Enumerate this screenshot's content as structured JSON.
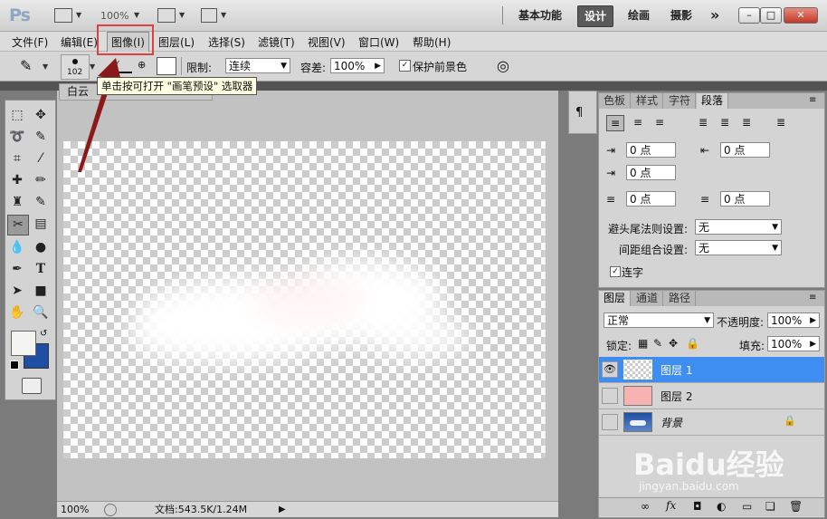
{
  "app": {
    "logo": "Ps",
    "zoom": "100%"
  },
  "workspaces": {
    "basic": "基本功能",
    "design": "设计",
    "paint": "绘画",
    "photo": "摄影",
    "more": "»"
  },
  "window_buttons": {
    "minimize": "–",
    "maximize": "□",
    "close": "✕"
  },
  "menu": [
    "文件(F)",
    "编辑(E)",
    "图像(I)",
    "图层(L)",
    "选择(S)",
    "滤镜(T)",
    "视图(V)",
    "窗口(W)",
    "帮助(H)"
  ],
  "options": {
    "brush_size": "102",
    "limit_label": "限制:",
    "limit_value": "连续",
    "tolerance_label": "容差:",
    "tolerance_value": "100%",
    "protect_fg_label": "保护前景色",
    "protect_fg_checked": true
  },
  "tooltip": "单击按可打开 \"画笔预设\" 选取器",
  "document": {
    "tab_title": "白云",
    "zoom": "100%",
    "doc_info": "文档:543.5K/1.24M"
  },
  "para_panel": {
    "tabs": [
      "色板",
      "样式",
      "字符",
      "段落"
    ],
    "active_tab": "段落",
    "indent_left": "0 点",
    "indent_right": "0 点",
    "indent_first": "0 点",
    "space_before": "0 点",
    "space_after": "0 点",
    "kinsoku_label": "避头尾法则设置:",
    "kinsoku_value": "无",
    "mojikumi_label": "间距组合设置:",
    "mojikumi_value": "无",
    "hyphenate_label": "连字",
    "hyphenate_checked": true
  },
  "layers_panel": {
    "tabs": [
      "图层",
      "通道",
      "路径"
    ],
    "active_tab": "图层",
    "blend_mode": "正常",
    "opacity_label": "不透明度:",
    "opacity_value": "100%",
    "lock_label": "锁定:",
    "fill_label": "填充:",
    "fill_value": "100%",
    "layers": [
      {
        "name": "图层 1",
        "selected": true,
        "visible": true
      },
      {
        "name": "图层 2",
        "selected": false,
        "visible": false
      },
      {
        "name": "背景",
        "selected": false,
        "visible": false,
        "locked": true
      }
    ]
  },
  "watermark": {
    "brand": "Baidu经验",
    "url": "jingyan.baidu.com"
  },
  "colors": {
    "selected_layer": "#3d8ef0",
    "layer2_thumb": "#f7b2b2",
    "foreground": "#f4f4f0",
    "background": "#1f4fa3",
    "highlight_box": "#e04040",
    "arrow": "#8a1a1a"
  }
}
